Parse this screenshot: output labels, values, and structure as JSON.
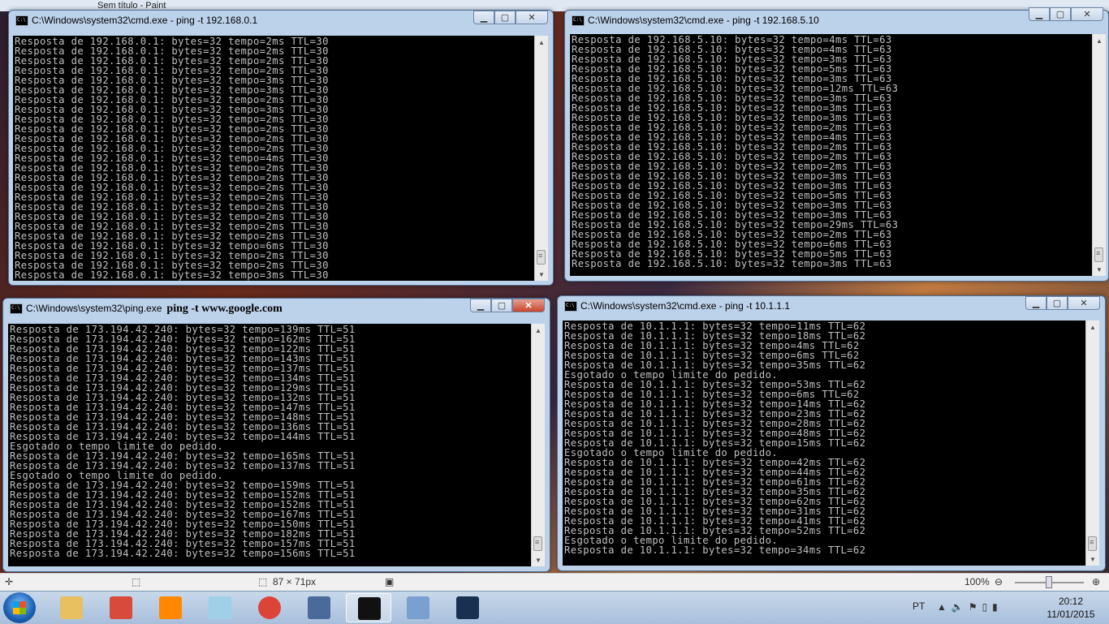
{
  "paint": {
    "title": "Sem título - Paint",
    "status": {
      "size": "87 × 71px",
      "zoom": "100%"
    }
  },
  "windows": [
    {
      "id": "w1",
      "title": "C:\\Windows\\system32\\cmd.exe - ping  -t 192.168.0.1",
      "lines": [
        "Resposta de 192.168.0.1: bytes=32 tempo=2ms TTL=30",
        "Resposta de 192.168.0.1: bytes=32 tempo=2ms TTL=30",
        "Resposta de 192.168.0.1: bytes=32 tempo=2ms TTL=30",
        "Resposta de 192.168.0.1: bytes=32 tempo=2ms TTL=30",
        "Resposta de 192.168.0.1: bytes=32 tempo=3ms TTL=30",
        "Resposta de 192.168.0.1: bytes=32 tempo=3ms TTL=30",
        "Resposta de 192.168.0.1: bytes=32 tempo=2ms TTL=30",
        "Resposta de 192.168.0.1: bytes=32 tempo=3ms TTL=30",
        "Resposta de 192.168.0.1: bytes=32 tempo=2ms TTL=30",
        "Resposta de 192.168.0.1: bytes=32 tempo=2ms TTL=30",
        "Resposta de 192.168.0.1: bytes=32 tempo=2ms TTL=30",
        "Resposta de 192.168.0.1: bytes=32 tempo=2ms TTL=30",
        "Resposta de 192.168.0.1: bytes=32 tempo=4ms TTL=30",
        "Resposta de 192.168.0.1: bytes=32 tempo=2ms TTL=30",
        "Resposta de 192.168.0.1: bytes=32 tempo=2ms TTL=30",
        "Resposta de 192.168.0.1: bytes=32 tempo=2ms TTL=30",
        "Resposta de 192.168.0.1: bytes=32 tempo=2ms TTL=30",
        "Resposta de 192.168.0.1: bytes=32 tempo=2ms TTL=30",
        "Resposta de 192.168.0.1: bytes=32 tempo=2ms TTL=30",
        "Resposta de 192.168.0.1: bytes=32 tempo=2ms TTL=30",
        "Resposta de 192.168.0.1: bytes=32 tempo=2ms TTL=30",
        "Resposta de 192.168.0.1: bytes=32 tempo=6ms TTL=30",
        "Resposta de 192.168.0.1: bytes=32 tempo=2ms TTL=30",
        "Resposta de 192.168.0.1: bytes=32 tempo=2ms TTL=30",
        "Resposta de 192.168.0.1: bytes=32 tempo=3ms TTL=30"
      ]
    },
    {
      "id": "w2",
      "title": "C:\\Windows\\system32\\cmd.exe - ping  -t 192.168.5.10",
      "lines": [
        "Resposta de 192.168.5.10: bytes=32 tempo=4ms TTL=63",
        "Resposta de 192.168.5.10: bytes=32 tempo=4ms TTL=63",
        "Resposta de 192.168.5.10: bytes=32 tempo=3ms TTL=63",
        "Resposta de 192.168.5.10: bytes=32 tempo=5ms TTL=63",
        "Resposta de 192.168.5.10: bytes=32 tempo=3ms TTL=63",
        "Resposta de 192.168.5.10: bytes=32 tempo=12ms TTL=63",
        "Resposta de 192.168.5.10: bytes=32 tempo=3ms TTL=63",
        "Resposta de 192.168.5.10: bytes=32 tempo=3ms TTL=63",
        "Resposta de 192.168.5.10: bytes=32 tempo=3ms TTL=63",
        "Resposta de 192.168.5.10: bytes=32 tempo=2ms TTL=63",
        "Resposta de 192.168.5.10: bytes=32 tempo=4ms TTL=63",
        "Resposta de 192.168.5.10: bytes=32 tempo=2ms TTL=63",
        "Resposta de 192.168.5.10: bytes=32 tempo=2ms TTL=63",
        "Resposta de 192.168.5.10: bytes=32 tempo=2ms TTL=63",
        "Resposta de 192.168.5.10: bytes=32 tempo=3ms TTL=63",
        "Resposta de 192.168.5.10: bytes=32 tempo=3ms TTL=63",
        "Resposta de 192.168.5.10: bytes=32 tempo=5ms TTL=63",
        "Resposta de 192.168.5.10: bytes=32 tempo=3ms TTL=63",
        "Resposta de 192.168.5.10: bytes=32 tempo=3ms TTL=63",
        "Resposta de 192.168.5.10: bytes=32 tempo=29ms TTL=63",
        "Resposta de 192.168.5.10: bytes=32 tempo=2ms TTL=63",
        "Resposta de 192.168.5.10: bytes=32 tempo=6ms TTL=63",
        "Resposta de 192.168.5.10: bytes=32 tempo=5ms TTL=63",
        "Resposta de 192.168.5.10: bytes=32 tempo=3ms TTL=63"
      ]
    },
    {
      "id": "w3",
      "title": "C:\\Windows\\system32\\ping.exe",
      "title_extra": "ping -t www.google.com",
      "lines": [
        "Resposta de 173.194.42.240: bytes=32 tempo=139ms TTL=51",
        "Resposta de 173.194.42.240: bytes=32 tempo=162ms TTL=51",
        "Resposta de 173.194.42.240: bytes=32 tempo=122ms TTL=51",
        "Resposta de 173.194.42.240: bytes=32 tempo=143ms TTL=51",
        "Resposta de 173.194.42.240: bytes=32 tempo=137ms TTL=51",
        "Resposta de 173.194.42.240: bytes=32 tempo=134ms TTL=51",
        "Resposta de 173.194.42.240: bytes=32 tempo=129ms TTL=51",
        "Resposta de 173.194.42.240: bytes=32 tempo=132ms TTL=51",
        "Resposta de 173.194.42.240: bytes=32 tempo=147ms TTL=51",
        "Resposta de 173.194.42.240: bytes=32 tempo=148ms TTL=51",
        "Resposta de 173.194.42.240: bytes=32 tempo=136ms TTL=51",
        "Resposta de 173.194.42.240: bytes=32 tempo=144ms TTL=51",
        "Esgotado o tempo limite do pedido.",
        "Resposta de 173.194.42.240: bytes=32 tempo=165ms TTL=51",
        "Resposta de 173.194.42.240: bytes=32 tempo=137ms TTL=51",
        "Esgotado o tempo limite do pedido.",
        "Resposta de 173.194.42.240: bytes=32 tempo=159ms TTL=51",
        "Resposta de 173.194.42.240: bytes=32 tempo=152ms TTL=51",
        "Resposta de 173.194.42.240: bytes=32 tempo=152ms TTL=51",
        "Resposta de 173.194.42.240: bytes=32 tempo=167ms TTL=51",
        "Resposta de 173.194.42.240: bytes=32 tempo=150ms TTL=51",
        "Resposta de 173.194.42.240: bytes=32 tempo=182ms TTL=51",
        "Resposta de 173.194.42.240: bytes=32 tempo=157ms TTL=51",
        "Resposta de 173.194.42.240: bytes=32 tempo=156ms TTL=51"
      ]
    },
    {
      "id": "w4",
      "title": "C:\\Windows\\system32\\cmd.exe - ping  -t 10.1.1.1",
      "lines": [
        "Resposta de 10.1.1.1: bytes=32 tempo=11ms TTL=62",
        "Resposta de 10.1.1.1: bytes=32 tempo=18ms TTL=62",
        "Resposta de 10.1.1.1: bytes=32 tempo=4ms TTL=62",
        "Resposta de 10.1.1.1: bytes=32 tempo=6ms TTL=62",
        "Resposta de 10.1.1.1: bytes=32 tempo=35ms TTL=62",
        "Esgotado o tempo limite do pedido.",
        "Resposta de 10.1.1.1: bytes=32 tempo=53ms TTL=62",
        "Resposta de 10.1.1.1: bytes=32 tempo=6ms TTL=62",
        "Resposta de 10.1.1.1: bytes=32 tempo=14ms TTL=62",
        "Resposta de 10.1.1.1: bytes=32 tempo=23ms TTL=62",
        "Resposta de 10.1.1.1: bytes=32 tempo=28ms TTL=62",
        "Resposta de 10.1.1.1: bytes=32 tempo=48ms TTL=62",
        "Resposta de 10.1.1.1: bytes=32 tempo=15ms TTL=62",
        "Esgotado o tempo limite do pedido.",
        "Resposta de 10.1.1.1: bytes=32 tempo=42ms TTL=62",
        "Resposta de 10.1.1.1: bytes=32 tempo=44ms TTL=62",
        "Resposta de 10.1.1.1: bytes=32 tempo=61ms TTL=62",
        "Resposta de 10.1.1.1: bytes=32 tempo=35ms TTL=62",
        "Resposta de 10.1.1.1: bytes=32 tempo=62ms TTL=62",
        "Resposta de 10.1.1.1: bytes=32 tempo=31ms TTL=62",
        "Resposta de 10.1.1.1: bytes=32 tempo=41ms TTL=62",
        "Resposta de 10.1.1.1: bytes=32 tempo=52ms TTL=62",
        "Esgotado o tempo limite do pedido.",
        "Resposta de 10.1.1.1: bytes=32 tempo=34ms TTL=62"
      ]
    }
  ],
  "taskbar": {
    "apps": [
      {
        "name": "windows-explorer",
        "color": "#e8c060"
      },
      {
        "name": "media-center",
        "color": "#d84a3a"
      },
      {
        "name": "vlc",
        "color": "#ff8800"
      },
      {
        "name": "notepad",
        "color": "#9fd0e8"
      },
      {
        "name": "chrome",
        "color": "#db4437"
      },
      {
        "name": "document",
        "color": "#4a6a9a"
      },
      {
        "name": "cmd",
        "color": "#111111",
        "active": true
      },
      {
        "name": "paint",
        "color": "#7aa0d0"
      },
      {
        "name": "league-of-legends",
        "color": "#1a3050"
      }
    ],
    "language": "PT",
    "time": "20:12",
    "date": "11/01/2015"
  }
}
